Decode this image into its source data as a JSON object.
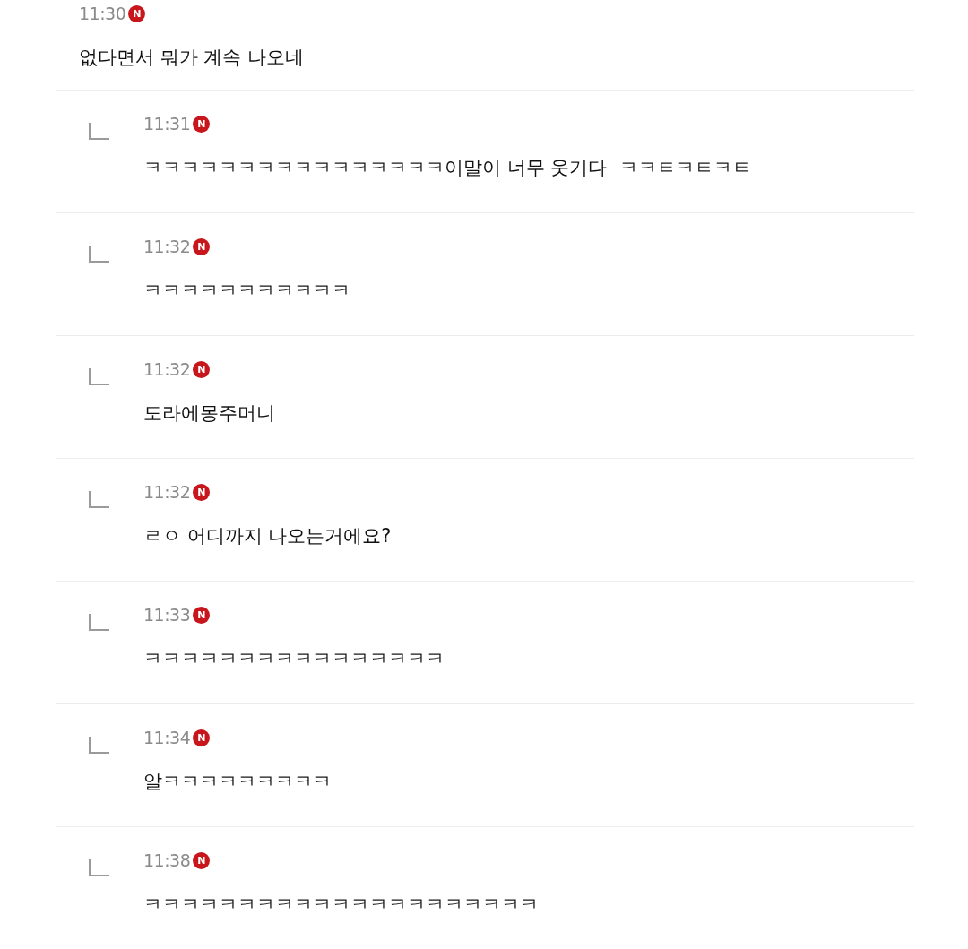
{
  "comments": [
    {
      "kind": "comment",
      "time": "11:30",
      "badge": "N",
      "text": "없다면서 뭐가 계속 나오네"
    },
    {
      "kind": "reply",
      "time": "11:31",
      "badge": "N",
      "text": "ㅋㅋㅋㅋㅋㅋㅋㅋㅋㅋㅋㅋㅋㅋㅋㅋ이말이 너무 웃기다  ㅋㅋㅌㅋㅌㅋㅌ"
    },
    {
      "kind": "reply",
      "time": "11:32",
      "badge": "N",
      "text": "ㅋㅋㅋㅋㅋㅋㅋㅋㅋㅋㅋ"
    },
    {
      "kind": "reply",
      "time": "11:32",
      "badge": "N",
      "text": "도라에몽주머니"
    },
    {
      "kind": "reply",
      "time": "11:32",
      "badge": "N",
      "text": "ㄹㅇ 어디까지 나오는거에요?"
    },
    {
      "kind": "reply",
      "time": "11:33",
      "badge": "N",
      "text": "ㅋㅋㅋㅋㅋㅋㅋㅋㅋㅋㅋㅋㅋㅋㅋㅋ"
    },
    {
      "kind": "reply",
      "time": "11:34",
      "badge": "N",
      "text": "알ㅋㅋㅋㅋㅋㅋㅋㅋㅋ"
    },
    {
      "kind": "reply",
      "time": "11:38",
      "badge": "N",
      "text": "ㅋㅋㅋㅋㅋㅋㅋㅋㅋㅋㅋㅋㅋㅋㅋㅋㅋㅋㅋㅋㅋ"
    }
  ]
}
